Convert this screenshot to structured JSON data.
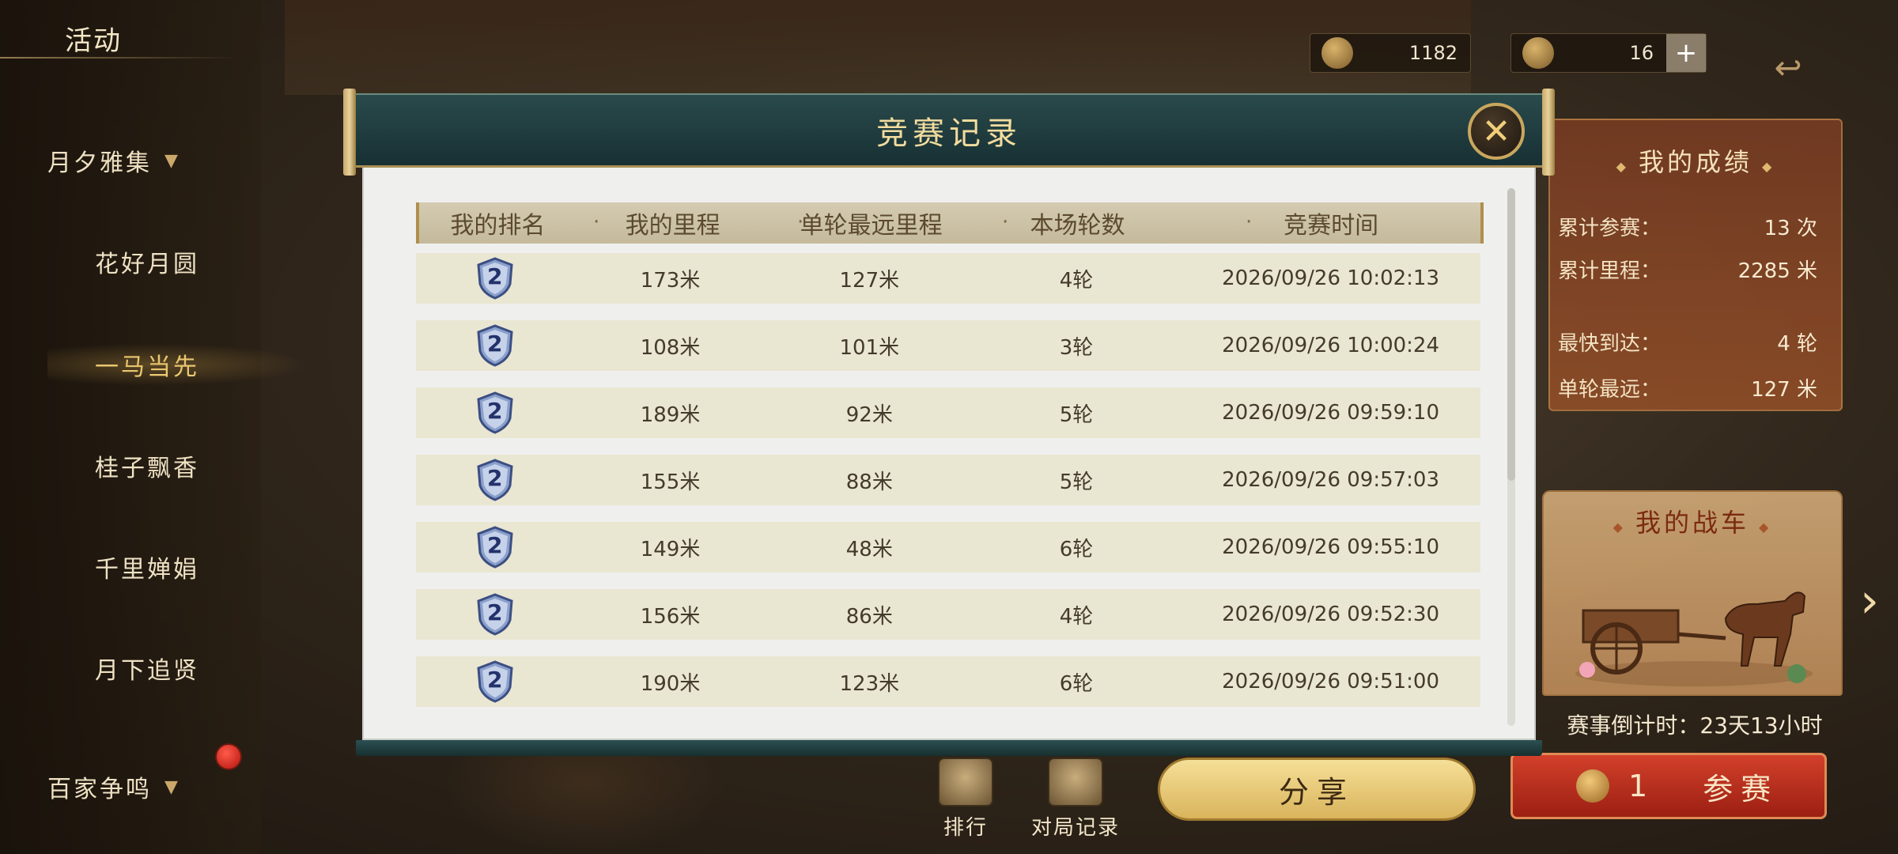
{
  "sidebar": {
    "title": "活动",
    "items": [
      {
        "label": "月夕雅集",
        "chevron": true
      },
      {
        "label": "花好月圆"
      },
      {
        "label": "一马当先",
        "active": true
      },
      {
        "label": "桂子飘香"
      },
      {
        "label": "千里婵娟"
      },
      {
        "label": "月下追贤"
      },
      {
        "label": "百家争鸣",
        "chevron": true
      }
    ]
  },
  "resources": {
    "res1_value": "1182",
    "res2_value": "16",
    "plus_label": "+"
  },
  "results": {
    "title": "我的成绩",
    "stats": [
      {
        "label": "累计参赛：",
        "value": "13 次"
      },
      {
        "label": "累计里程：",
        "value": "2285 米"
      },
      {
        "label": "最快到达：",
        "value": "4 轮"
      },
      {
        "label": "单轮最远：",
        "value": "127 米"
      }
    ]
  },
  "chariot": {
    "title": "我的战车"
  },
  "countdown": "赛事倒计时：23天13小时",
  "bottom": {
    "rank_label": "排行",
    "history_label": "对局记录",
    "share_label": "分享",
    "join_cost": "1",
    "join_label": "参赛"
  },
  "modal": {
    "title": "竞赛记录",
    "close_icon": "close-x",
    "headers": [
      "我的排名",
      "我的里程",
      "单轮最远里程",
      "本场轮数",
      "竞赛时间"
    ],
    "separator": "·",
    "rows": [
      {
        "rank": "2",
        "distance": "173米",
        "best": "127米",
        "rounds": "4轮",
        "time": "2026/09/26 10:02:13"
      },
      {
        "rank": "2",
        "distance": "108米",
        "best": "101米",
        "rounds": "3轮",
        "time": "2026/09/26 10:00:24"
      },
      {
        "rank": "2",
        "distance": "189米",
        "best": "92米",
        "rounds": "5轮",
        "time": "2026/09/26 09:59:10"
      },
      {
        "rank": "2",
        "distance": "155米",
        "best": "88米",
        "rounds": "5轮",
        "time": "2026/09/26 09:57:03"
      },
      {
        "rank": "2",
        "distance": "149米",
        "best": "48米",
        "rounds": "6轮",
        "time": "2026/09/26 09:55:10"
      },
      {
        "rank": "2",
        "distance": "156米",
        "best": "86米",
        "rounds": "4轮",
        "time": "2026/09/26 09:52:30"
      },
      {
        "rank": "2",
        "distance": "190米",
        "best": "123米",
        "rounds": "6轮",
        "time": "2026/09/26 09:51:00"
      }
    ]
  },
  "colors": {
    "modal_header": "#173033",
    "modal_title": "#f2dc9e",
    "share_button": "#d9b45c",
    "join_button": "#9c1f12"
  }
}
